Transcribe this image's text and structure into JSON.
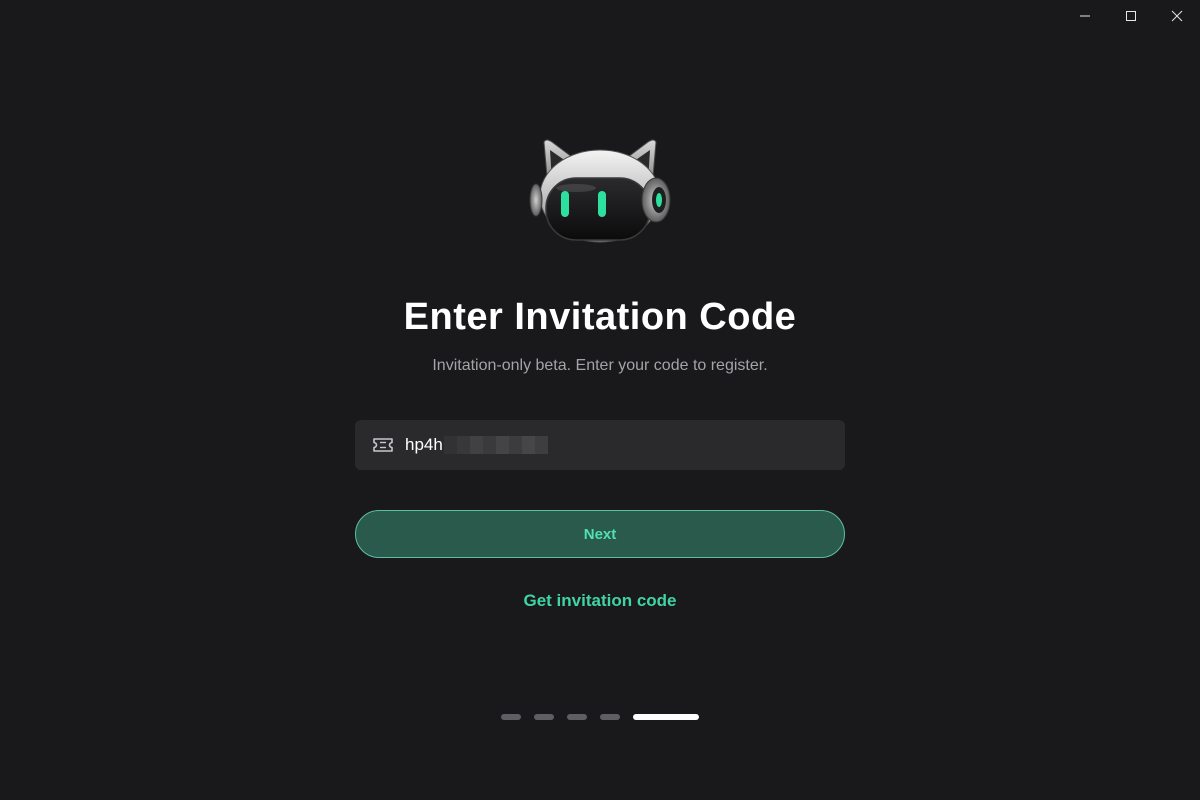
{
  "window_controls": {
    "minimize_icon": "minimize-icon",
    "maximize_icon": "maximize-icon",
    "close_icon": "close-icon"
  },
  "mascot": {
    "icon": "robot-cat-mascot",
    "eye_color": "#2de0a0"
  },
  "title": "Enter Invitation Code",
  "subtitle": "Invitation-only beta. Enter your code to register.",
  "code_field": {
    "icon": "ticket-icon",
    "value": "hp4h"
  },
  "next_button": {
    "label": "Next"
  },
  "get_code_link": {
    "label": "Get invitation code"
  },
  "pager": {
    "total": 5,
    "active_index": 4
  },
  "colors": {
    "background": "#19191b",
    "accent": "#3fd4a2",
    "button_fill": "#2a5a4c",
    "field_fill": "#2a2a2d"
  }
}
